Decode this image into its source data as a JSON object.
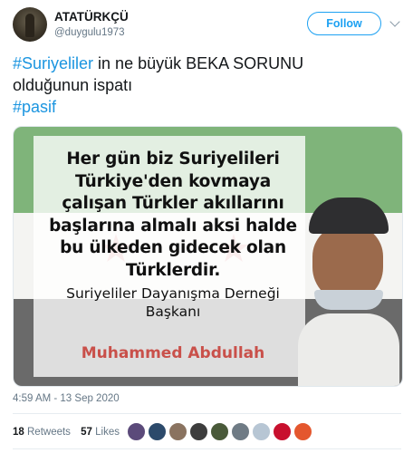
{
  "user": {
    "name": "ATATÜRKÇÜ",
    "handle": "@duygulu1973"
  },
  "header": {
    "follow_label": "Follow"
  },
  "tweet": {
    "hashtag1": "#Suriyeliler",
    "text_line1": " in ne büyük BEKA SORUNU",
    "text_line2": "olduğunun ispatı",
    "hashtag2": "#pasif"
  },
  "media": {
    "quote_lines": [
      "Her gün biz Suriyelileri",
      "Türkiye'den kovmaya",
      "çalışan Türkler akıllarını",
      "başlarına almalı aksi halde",
      "bu ülkeden gidecek olan",
      "Türklerdir."
    ],
    "org_lines": [
      "Suriyeliler Dayanışma Derneği",
      "Başkanı"
    ],
    "author": "Muhammed Abdullah"
  },
  "meta": {
    "timestamp": "4:59 AM - 13 Sep 2020"
  },
  "stats": {
    "retweets_count": "18",
    "retweets_label": "Retweets",
    "likes_count": "57",
    "likes_label": "Likes"
  },
  "likers": {
    "colors": [
      "#5b4a7a",
      "#2c4a6b",
      "#8a7360",
      "#3d3d3d",
      "#4a5a3a",
      "#6f7b85",
      "#b7c6d4",
      "#c8102e",
      "#e4572e"
    ]
  }
}
